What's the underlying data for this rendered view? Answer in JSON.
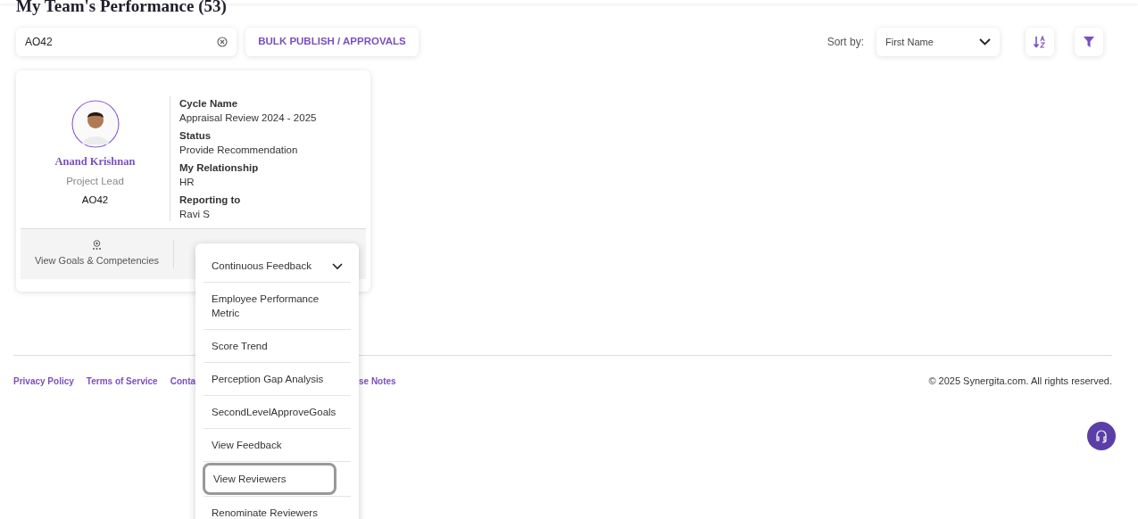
{
  "page_title": "My Team's Performance (53)",
  "search": {
    "value": "AO42"
  },
  "bulk_button": "BULK PUBLISH / APPROVALS",
  "sort": {
    "label": "Sort by:",
    "value": "First Name"
  },
  "card": {
    "name": "Anand Krishnan",
    "role": "Project Lead",
    "code": "AO42",
    "fields": [
      {
        "label": "Cycle Name",
        "value": "Appraisal Review 2024 - 2025"
      },
      {
        "label": "Status",
        "value": "Provide Recommendation"
      },
      {
        "label": "My Relationship",
        "value": "HR"
      },
      {
        "label": "Reporting to",
        "value": "Ravi S"
      }
    ],
    "action": "View Goals & Competencies"
  },
  "menu": {
    "header": "Continuous Feedback",
    "items": [
      {
        "label": "Employee Performance Metric",
        "selected": false
      },
      {
        "label": "Score Trend",
        "selected": false
      },
      {
        "label": "Perception Gap Analysis",
        "selected": false
      },
      {
        "label": "SecondLevelApproveGoals",
        "selected": false
      },
      {
        "label": "View Feedback",
        "selected": false
      },
      {
        "label": "View Reviewers",
        "selected": true
      },
      {
        "label": "Renominate Reviewers",
        "selected": false
      }
    ]
  },
  "footer": {
    "links_left": [
      "Privacy Policy",
      "Terms of Service",
      "Conta"
    ],
    "links_right": [
      "se Notes"
    ],
    "copyright": "© 2025 Synergita.com. All rights reserved."
  }
}
